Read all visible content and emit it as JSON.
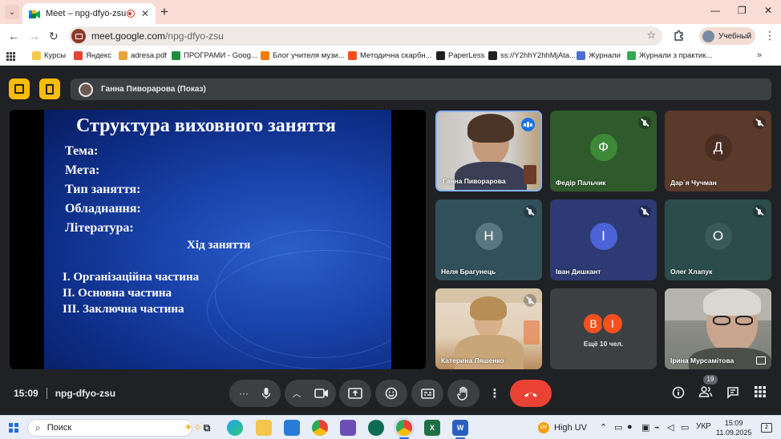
{
  "browser": {
    "tab_title": "Meet – npg-dfyo-zsu",
    "tab_close": "✕",
    "new_tab": "+",
    "window_controls": {
      "minimize": "—",
      "restore": "❐",
      "close": "✕"
    },
    "back": "←",
    "forward": "→",
    "reload": "↻",
    "url_host": "meet.google.com",
    "url_path": "/npg-dfyo-zsu",
    "star": "☆",
    "extensions_icon": "extensions-puzzle-icon",
    "profile_name": "Учебный",
    "menu": "⋮",
    "bookmarks_more": "»",
    "bookmarks": [
      {
        "label": "Курсы",
        "color": "#f2c94c"
      },
      {
        "label": "Яндекс",
        "color": "#e94235"
      },
      {
        "label": "adresa.pdf",
        "color": "#e8a33c"
      },
      {
        "label": "ПРОГРАМИ - Goog...",
        "color": "#1e8e3e"
      },
      {
        "label": "Блог учителя музи...",
        "color": "#f57c00"
      },
      {
        "label": "Методична скарбн...",
        "color": "#f4511e"
      },
      {
        "label": "PaperLess",
        "color": "#202124"
      },
      {
        "label": "ss://Y2hhY2hhMjAta...",
        "color": "#202124"
      },
      {
        "label": "Журнали",
        "color": "#4d6fd1"
      },
      {
        "label": "Журнали з практик...",
        "color": "#34a853"
      }
    ]
  },
  "meet": {
    "presenter_label": "Ганна Пиворарова (Показ)",
    "slide": {
      "title": "Структура виховного заняття",
      "fields": [
        "Тема:",
        "Мета:",
        "Тип заняття:",
        "Обладнання:",
        "Література:"
      ],
      "subtitle": "Хід заняття",
      "parts": [
        "I. Організаційна частина",
        "II. Основна частина",
        "III. Заключна частина"
      ]
    },
    "tiles": [
      {
        "name": "Ганна Пиворарова",
        "type": "video",
        "state": "speaking"
      },
      {
        "name": "Федір Пальчик",
        "letter": "Ф",
        "bg": "#2f5a2c",
        "circle": "#3c8a37",
        "state": "muted"
      },
      {
        "name": "Дар`я Чучман",
        "letter": "Д",
        "bg": "#5a3a2b",
        "circle": "#4a2e22",
        "state": "muted"
      },
      {
        "name": "Неля Брагунець",
        "letter": "Н",
        "bg": "#31505a",
        "circle": "#5a7680",
        "state": "muted"
      },
      {
        "name": "Іван Дишкант",
        "letter": "І",
        "bg": "#2d3a73",
        "circle": "#4b63d6",
        "state": "muted"
      },
      {
        "name": "Олег Хлапук",
        "letter": "О",
        "bg": "#2c4c4c",
        "circle": "#3a5a5a",
        "state": "muted"
      },
      {
        "name": "Катерина Ляшенко",
        "type": "video",
        "state": "muted"
      },
      {
        "type": "more",
        "label": "Ещё 10 чел.",
        "avatars": [
          {
            "letter": "В",
            "color": "#f4511e"
          },
          {
            "letter": "І",
            "color": "#f4511e"
          }
        ]
      },
      {
        "name": "Ірина Мурсамітова",
        "type": "video",
        "state": "none"
      }
    ],
    "time": "15:09",
    "meeting_code": "npg-dfyo-zsu",
    "participants_count": "19"
  },
  "taskbar": {
    "search_placeholder": "Поиск",
    "weather": "High UV",
    "uv_badge": "UV",
    "lang": "УКР",
    "time": "15:09",
    "date": "11.09.2025",
    "notifications": "2"
  }
}
